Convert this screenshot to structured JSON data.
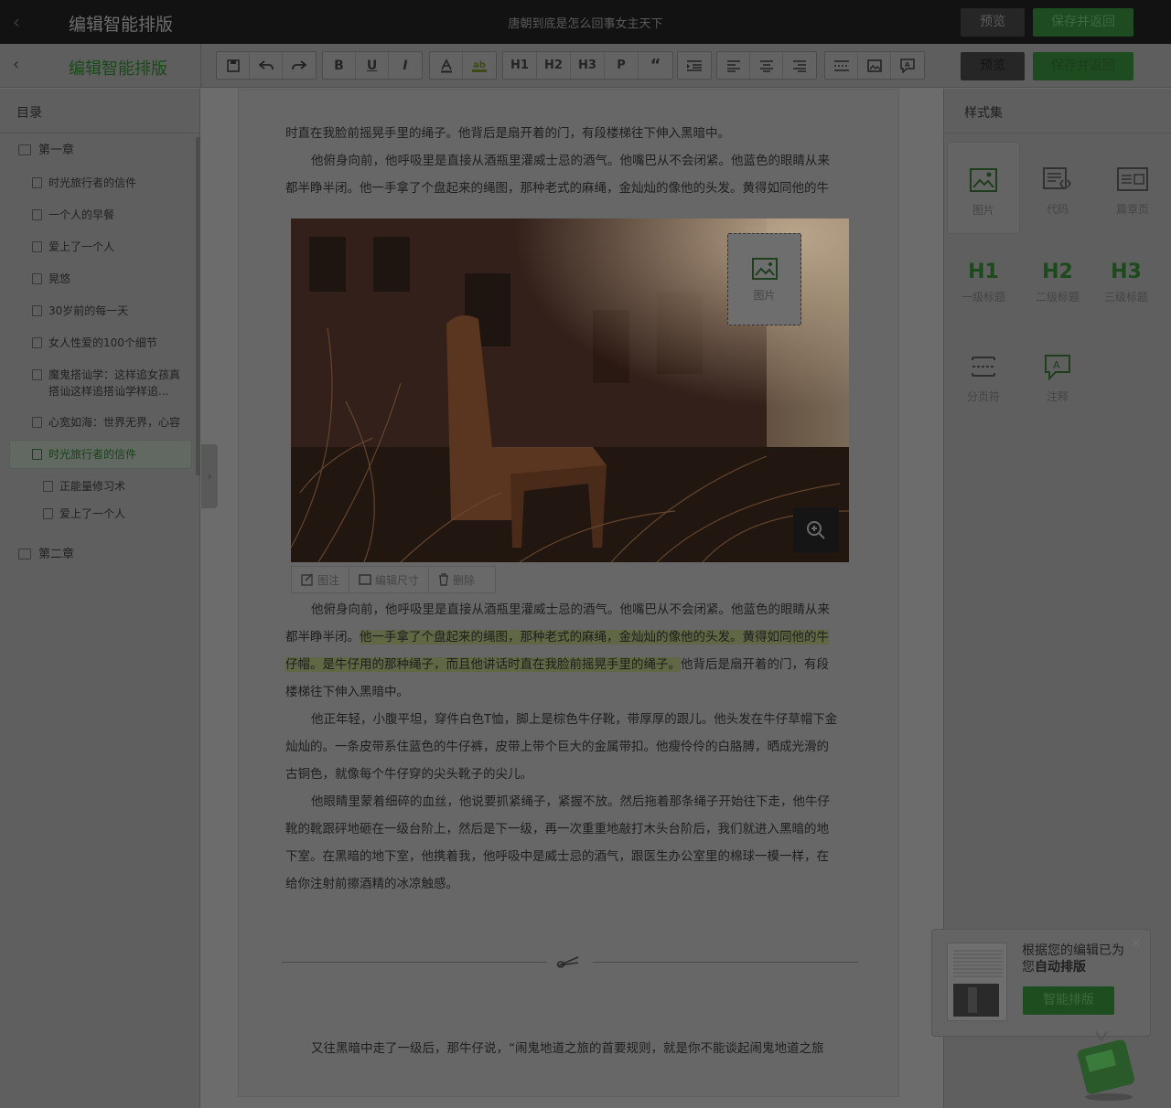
{
  "topbar": {
    "title": "编辑智能排版",
    "doc_title": "唐朝到底是怎么回事女主天下",
    "preview": "预览",
    "save": "保存并返回"
  },
  "header": {
    "title": "编辑智能排版",
    "preview": "预览",
    "save": "保存并返回"
  },
  "toolbar": {
    "bold": "B",
    "underline": "U",
    "italic": "I",
    "h1": "H1",
    "h2": "H2",
    "h3": "H3",
    "p": "P",
    "quote": "“"
  },
  "sidebar": {
    "heading": "目录",
    "items": [
      {
        "label": "第一章"
      },
      {
        "label": "时光旅行者的信件"
      },
      {
        "label": "一个人的早餐"
      },
      {
        "label": "爱上了一个人"
      },
      {
        "label": "晃悠"
      },
      {
        "label": "30岁前的每一天"
      },
      {
        "label": "女人性爱的100个细节"
      },
      {
        "label": "魔鬼搭讪学：这样追女孩真搭讪这样追搭讪学样追..."
      },
      {
        "label": "心宽如海：世界无界，心容"
      },
      {
        "label": "时光旅行者的信件"
      },
      {
        "label": "正能量修习术"
      },
      {
        "label": "爱上了一个人"
      },
      {
        "label": "第二章"
      }
    ]
  },
  "editor": {
    "p0": "时直在我脸前摇晃手里的绳子。他背后是扇开着的门，有段楼梯往下伸入黑暗中。",
    "p1a": "他俯身向前，他呼吸里是直接从酒瓶里灌威士忌的酒气。他嘴巴从不会闭紧。他蓝色的眼睛从来",
    "p1b": "都半睁半闭。他一手拿了个盘起来的绳图，那种老式的麻绳，金灿灿的像他的头发。黄得如同他的牛",
    "p2a": "他俯身向前，他呼吸里是直接从酒瓶里灌威士忌的酒气。他嘴巴从不会闭紧。他蓝色的眼睛从来",
    "p2b_plain": "都半睁半闭。",
    "p2b_hl": "他一手拿了个盘起来的绳图，那种老式的麻绳，金灿灿的像他的头发。黄得如同他的牛",
    "p2c_hl": "仔帽。是牛仔用的那种绳子，而且他讲话时直在我脸前摇晃手里的绳子。",
    "p2c_plain": "他背后是扇开着的门，有段",
    "p2d": "楼梯往下伸入黑暗中。",
    "p3a": "他正年轻，小腹平坦，穿件白色T恤，脚上是棕色牛仔靴，带厚厚的跟儿。他头发在牛仔草帽下金",
    "p3b": "灿灿的。一条皮带系住蓝色的牛仔裤，皮带上带个巨大的金属带扣。他瘦伶伶的白胳膊，晒成光滑的",
    "p3c": "古铜色，就像每个牛仔穿的尖头靴子的尖儿。",
    "p4a": "他眼睛里蒙着细碎的血丝，他说要抓紧绳子，紧握不放。然后拖着那条绳子开始往下走，他牛仔",
    "p4b": "靴的靴跟砰地砸在一级台阶上，然后是下一级，再一次重重地敲打木头台阶后，我们就进入黑暗的地",
    "p4c": "下室。在黑暗的地下室，他携着我，他呼吸中是威士忌的酒气，跟医生办公室里的棉球一模一样，在",
    "p4d": "给你注射前擦酒精的冰凉触感。",
    "p5": "又往黑暗中走了一级后，那牛仔说，“闹鬼地道之旅的首要规则，就是你不能谈起闹鬼地道之旅",
    "image_placeholder": "图片",
    "image_actions": {
      "caption": "图注",
      "resize": "编辑尺寸",
      "delete": "删除"
    }
  },
  "styles": {
    "heading": "样式集",
    "image": "图片",
    "code": "代码",
    "cover": "篇章页",
    "h1": "H1",
    "h1_label": "一级标题",
    "h2": "H2",
    "h2_label": "二级标题",
    "h3": "H3",
    "h3_label": "三级标题",
    "pagebreak": "分页符",
    "note": "注释"
  },
  "popup": {
    "line1": "根据您的编辑已为您",
    "bold": "自动排版",
    "button": "智能排版"
  }
}
